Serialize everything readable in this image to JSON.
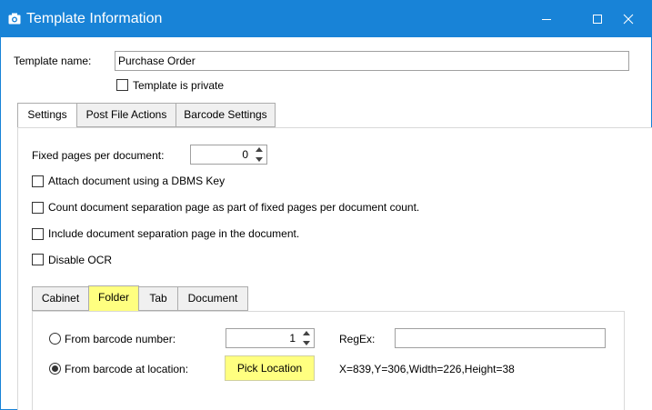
{
  "window": {
    "title": "Template Information",
    "icon": "camera-icon",
    "accent_color": "#1883d7"
  },
  "template": {
    "name_label": "Template name:",
    "name_value": "Purchase Order",
    "private_label": "Template is private",
    "private_checked": false
  },
  "tabs": [
    {
      "label": "Settings",
      "active": true
    },
    {
      "label": "Post File Actions",
      "active": false
    },
    {
      "label": "Barcode Settings",
      "active": false
    }
  ],
  "settings": {
    "fixed_pages_label": "Fixed pages per document:",
    "fixed_pages_value": "0",
    "options": [
      {
        "label": "Attach document using a DBMS Key",
        "checked": false
      },
      {
        "label": "Count document separation page as part of fixed pages per document count.",
        "checked": false
      },
      {
        "label": "Include document separation page in the document.",
        "checked": false
      },
      {
        "label": "Disable OCR",
        "checked": false
      }
    ]
  },
  "subtabs": [
    {
      "label": "Cabinet",
      "active": false
    },
    {
      "label": "Folder",
      "active": true,
      "highlight": "#ffff80"
    },
    {
      "label": "Tab",
      "active": false
    },
    {
      "label": "Document",
      "active": false
    }
  ],
  "folder": {
    "from_number_label": "From barcode number:",
    "from_number_value": "1",
    "from_number_selected": false,
    "regex_label": "RegEx:",
    "regex_value": "",
    "from_location_label": "From barcode at location:",
    "from_location_selected": true,
    "pick_location_label": "Pick Location",
    "location_text": "X=839,Y=306,Width=226,Height=38"
  }
}
